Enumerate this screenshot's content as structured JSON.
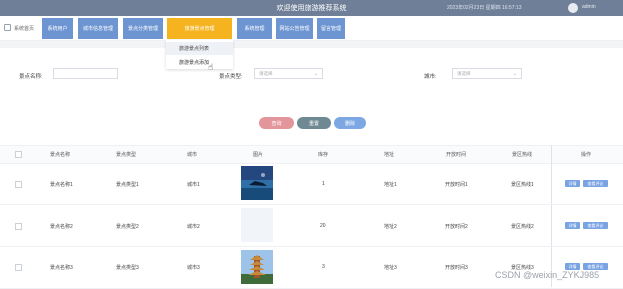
{
  "header": {
    "title": "欢迎使用旅游推荐系统",
    "time": "2023年02月23日 星期四 16:57:13",
    "user": "admin"
  },
  "nav": {
    "home": "系统首页",
    "tabs": [
      {
        "label": "系统用户"
      },
      {
        "label": "城市信息管理"
      },
      {
        "label": "景点分类管理"
      },
      {
        "label": "旅游景点管理"
      },
      {
        "label": "系统管理"
      },
      {
        "label": "网站公告管理"
      },
      {
        "label": "留言管理"
      }
    ],
    "dropdown": [
      "旅游景点列表",
      "旅游景点添加"
    ]
  },
  "filters": {
    "name_label": "景点名称:",
    "type_label": "景点类型:",
    "type_placeholder": "请选择",
    "city_label": "城市:",
    "city_placeholder": "请选择"
  },
  "actions": {
    "search": "查询",
    "reset": "重置",
    "delete": "删除"
  },
  "table": {
    "headers": [
      "景点名称",
      "景点类型",
      "城市",
      "图片",
      "库存",
      "地址",
      "开放时间",
      "景区热线",
      "操作"
    ],
    "rows": [
      {
        "name": "景点名称1",
        "type": "景点类型1",
        "city": "城市1",
        "stock": "1",
        "addr": "地址1",
        "open": "开放时间1",
        "hot": "景区热线1"
      },
      {
        "name": "景点名称2",
        "type": "景点类型2",
        "city": "城市2",
        "stock": "20",
        "addr": "地址2",
        "open": "开放时间2",
        "hot": "景区热线2"
      },
      {
        "name": "景点名称3",
        "type": "景点类型3",
        "city": "城市3",
        "stock": "3",
        "addr": "地址3",
        "open": "开放时间3",
        "hot": "景区热线3"
      }
    ],
    "op_detail": "详情",
    "op_review": "查看评论"
  },
  "watermark": "CSDN @weixin_ZYKJ985",
  "colors": {
    "topbar": "#6e7f97",
    "tab": "#6d95d2",
    "tab_active": "#f5b320",
    "btn_search": "#e3959c",
    "btn_reset": "#6f8993",
    "btn_delete": "#7da7e3"
  }
}
